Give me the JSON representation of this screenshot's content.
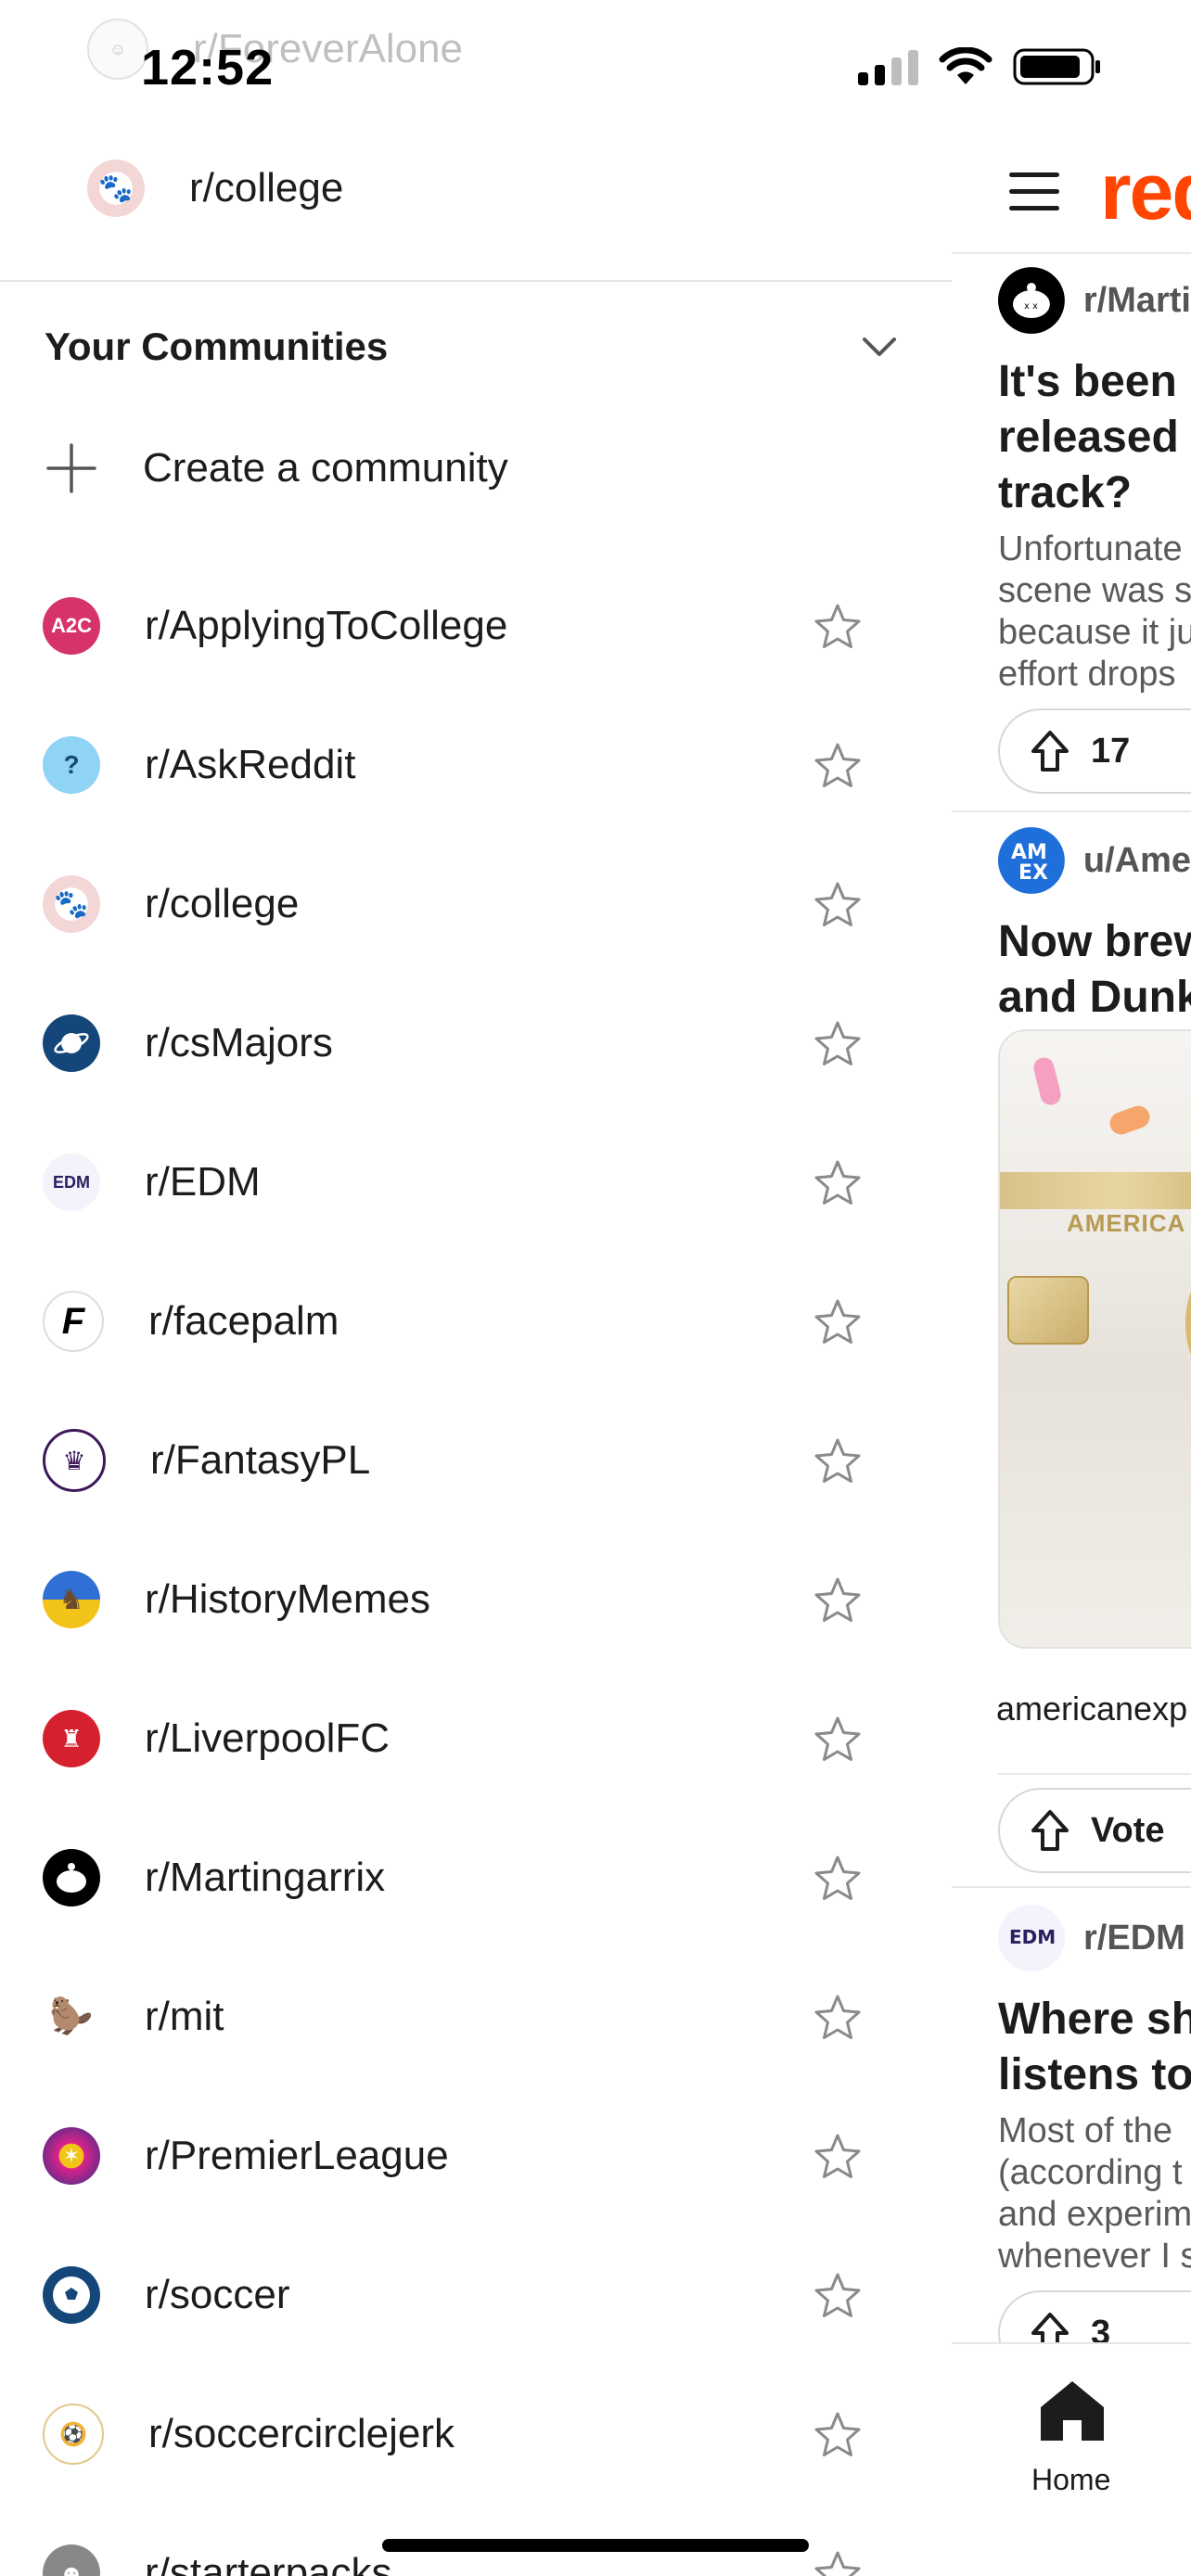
{
  "status_bar": {
    "time": "12:52"
  },
  "drawer": {
    "faded_item": "r/ForeverAlone",
    "recent_item": "r/college",
    "section_title": "Your Communities",
    "create_label": "Create a community",
    "communities": [
      {
        "name": "r/ApplyingToCollege"
      },
      {
        "name": "r/AskReddit"
      },
      {
        "name": "r/college"
      },
      {
        "name": "r/csMajors"
      },
      {
        "name": "r/EDM"
      },
      {
        "name": "r/facepalm"
      },
      {
        "name": "r/FantasyPL"
      },
      {
        "name": "r/HistoryMemes"
      },
      {
        "name": "r/LiverpoolFC"
      },
      {
        "name": "r/Martingarrix"
      },
      {
        "name": "r/mit"
      },
      {
        "name": "r/PremierLeague"
      },
      {
        "name": "r/soccer"
      },
      {
        "name": "r/soccercirclejerk"
      },
      {
        "name": "r/starterpacks"
      }
    ]
  },
  "feed": {
    "brand": "red",
    "posts": [
      {
        "sub": "r/Marti",
        "title_lines": [
          "It's been",
          "released",
          "track?"
        ],
        "body_lines": [
          "Unfortunate",
          "scene was s",
          "because it ju",
          "effort drops"
        ],
        "votes": "17"
      },
      {
        "sub": "u/Ame",
        "title_lines": [
          "Now brew",
          "and Dunk"
        ],
        "card_text": "AMERICA",
        "link": "americanexp",
        "vote_label": "Vote"
      },
      {
        "sub": "r/EDM",
        "title_lines": [
          "Where sh",
          "listens to"
        ],
        "body_lines": [
          "Most of the",
          "(according t",
          "and experim",
          "whenever I s"
        ],
        "votes": "3"
      }
    ],
    "nav_home": "Home"
  },
  "colors": {
    "brand": "#ff4500",
    "star": "#8a8a8a"
  }
}
